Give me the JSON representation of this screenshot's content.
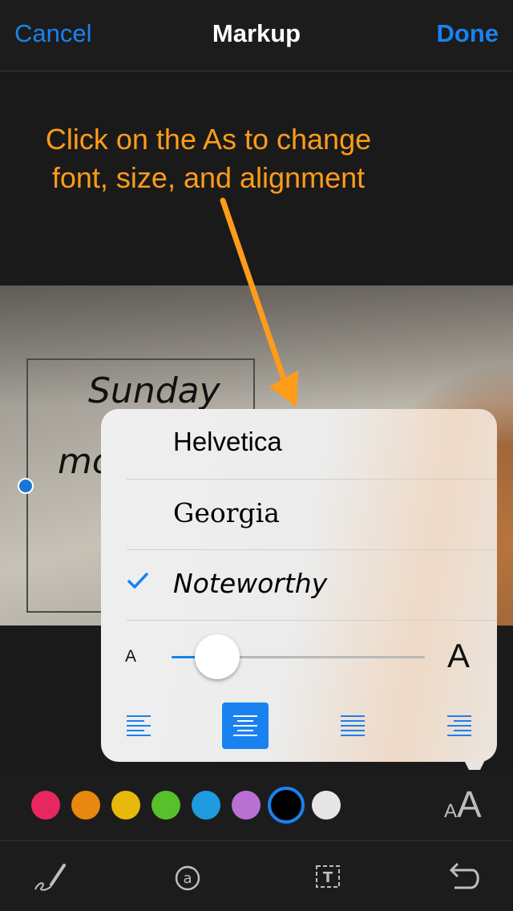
{
  "nav": {
    "cancel": "Cancel",
    "title": "Markup",
    "done": "Done"
  },
  "annotation": {
    "line1": "Click on the As to change",
    "line2": "font, size, and alignment"
  },
  "photo_text": {
    "line1": "Sunday",
    "line2": "mo"
  },
  "font_menu": {
    "fonts": [
      {
        "label": "Helvetica",
        "selected": false
      },
      {
        "label": "Georgia",
        "selected": false
      },
      {
        "label": "Noteworthy",
        "selected": true
      }
    ],
    "size_small_label": "A",
    "size_large_label": "A",
    "size_value": 0.18,
    "alignment": [
      "left",
      "center",
      "justified",
      "right"
    ],
    "selected_alignment": "center"
  },
  "colors": [
    "#e8265f",
    "#e9880e",
    "#e8b90c",
    "#56c12b",
    "#1f9be0",
    "#b970d2",
    "#000000",
    "#e6e6e6"
  ],
  "selected_color": "#000000",
  "text_style_button": {
    "small": "A",
    "large": "A"
  },
  "tools": [
    "signature-tool",
    "magnifier-tool",
    "text-tool",
    "undo-tool"
  ],
  "accent_color": "#1a82f0",
  "annotation_color": "#ff9c1a"
}
